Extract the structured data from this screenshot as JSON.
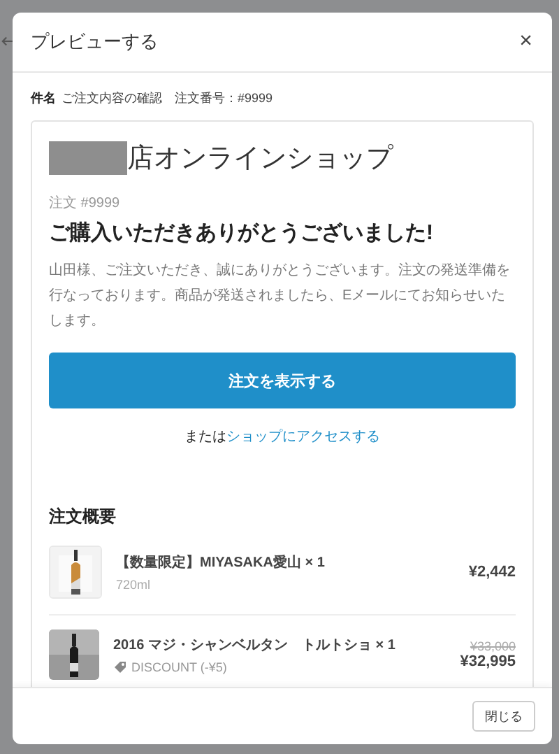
{
  "dialog": {
    "title": "プレビューする",
    "close_icon": "×"
  },
  "subject": {
    "label": "件名",
    "text": "ご注文内容の確認　注文番号：#9999"
  },
  "email": {
    "shop_name": "店オンラインショップ",
    "shop_name_redacted": true,
    "order_number": "注文 #9999",
    "heading": "ご購入いただきありがとうございました!",
    "message": "山田様、ご注文いただき、誠にありがとうございます。注文の発送準備を行なっております。商品が発送されましたら、Eメールにてお知らせいたします。",
    "view_button": "注文を表示する",
    "or_text": "または",
    "shop_link": "ショップにアクセスする",
    "summary_title": "注文概要",
    "items": [
      {
        "name": "【数量限定】MIYASAKA愛山 × 1",
        "variant": "720ml",
        "price": "¥2,442",
        "kind": "plain"
      },
      {
        "name": "2016 マジ・シャンベルタン　トルトショ × 1",
        "discount": "DISCOUNT (-¥5)",
        "original_price": "¥33,000",
        "price": "¥32,995",
        "kind": "discounted"
      }
    ]
  },
  "footer": {
    "close_button": "閉じる"
  }
}
